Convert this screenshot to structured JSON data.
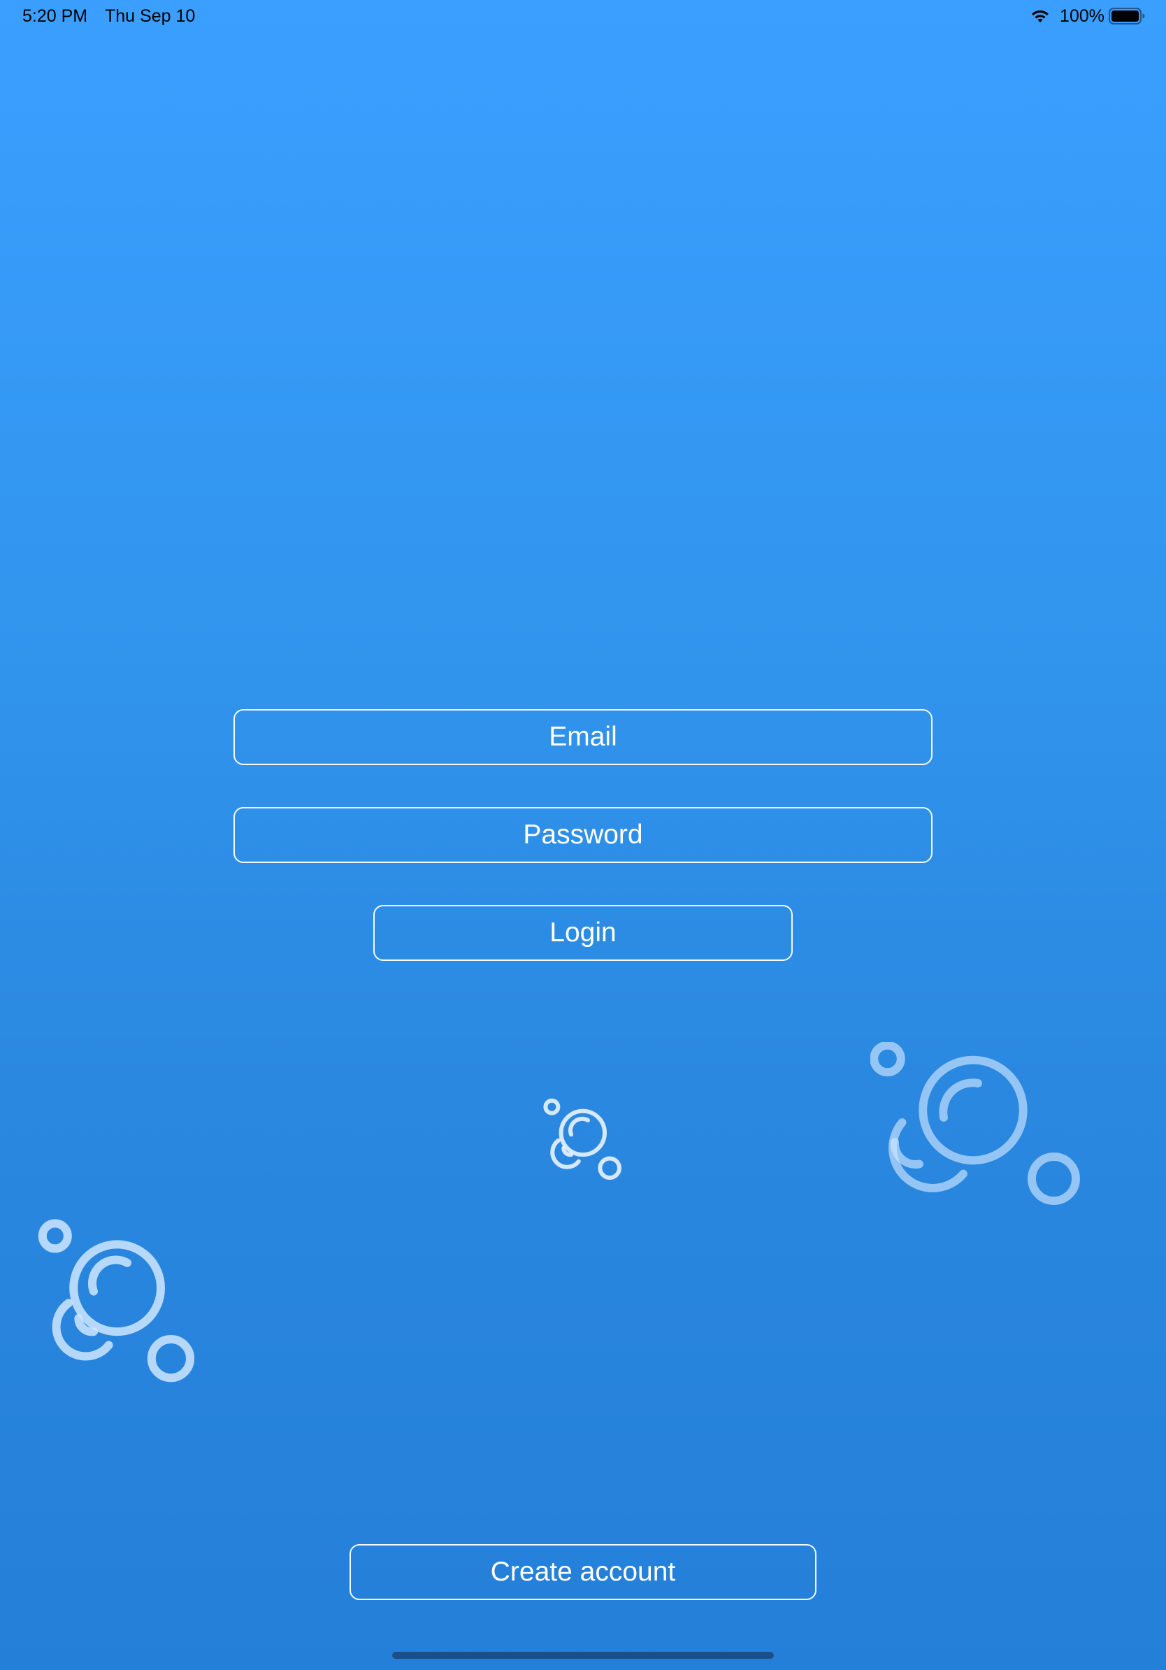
{
  "status_bar": {
    "time": "5:20 PM",
    "date": "Thu Sep 10",
    "battery_percent": "100%",
    "battery_level": 1.0,
    "icons": [
      "wifi-icon",
      "battery-icon"
    ]
  },
  "login_form": {
    "email_placeholder": "Email",
    "password_placeholder": "Password",
    "login_label": "Login"
  },
  "footer": {
    "create_account_label": "Create account"
  },
  "decorations": {
    "icon": "bubbles-icon"
  },
  "colors": {
    "background_top": "#3a9fff",
    "background_bottom": "#247fd8",
    "field_border": "#ffffff",
    "text": "#ffffff",
    "bubble_stroke": "#cfe6ff"
  }
}
